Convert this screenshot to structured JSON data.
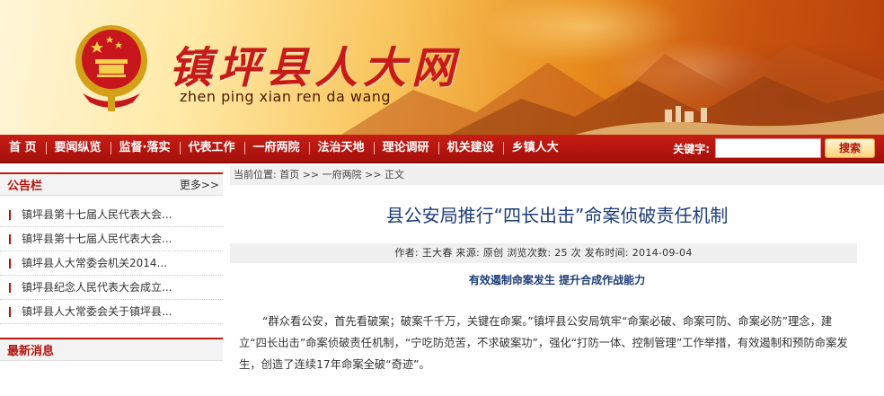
{
  "banner": {
    "title": "镇坪县人大网",
    "pinyin": "zhen ping xian ren da wang",
    "emblem_icon": "national-emblem-icon"
  },
  "nav": {
    "items": [
      "首 页",
      "要闻纵览",
      "监督·落实",
      "代表工作",
      "一府两院",
      "法治天地",
      "理论调研",
      "机关建设",
      "乡镇人大"
    ],
    "search_label": "关键字:",
    "search_placeholder": "",
    "search_button": "搜索"
  },
  "sidebar": {
    "notice": {
      "title": "公告栏",
      "more": "更多>>",
      "items": [
        "镇坪县第十七届人民代表大会...",
        "镇坪县第十七届人民代表大会...",
        "镇坪县人大常委会机关2014...",
        "镇坪县纪念人民代表大会成立...",
        "镇坪县人大常委会关于镇坪县..."
      ]
    },
    "news": {
      "title": "最新消息"
    }
  },
  "article": {
    "breadcrumb": "当前位置:  首页 >> 一府两院 >> 正文",
    "title": "县公安局推行“四长出击”命案侦破责任机制",
    "meta": "作者:  王大春     来源:  原创     浏览次数:  25 次     发布时间:  2014-09-04",
    "subtitle": "有效遏制命案发生  提升合成作战能力",
    "body": "“群众看公安，首先看破案；破案千千万，关键在命案。”镇坪县公安局筑牢“命案必破、命案可防、命案必防”理念，建立“四长出击”命案侦破责任机制，“宁吃防范苦，不求破案功”，强化“打防一体、控制管理”工作举措，有效遏制和预防命案发生，创造了连续17年命案全破“奇迹”。"
  },
  "colors": {
    "nav_red": "#b3130b",
    "title_blue": "#1e3d78",
    "banner_orange": "#e88b1c"
  }
}
